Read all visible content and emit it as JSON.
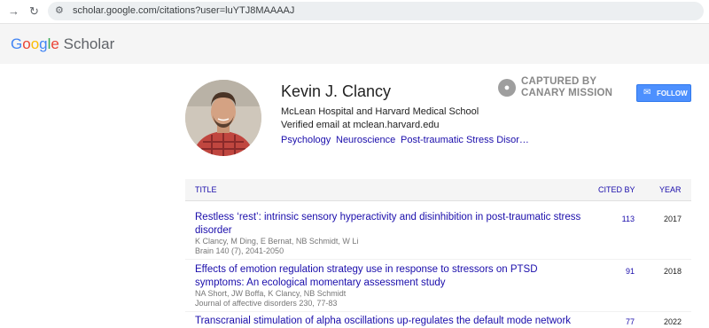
{
  "browser": {
    "back_icon": "arrow-back-icon",
    "reload_icon": "reload-icon",
    "url": "scholar.google.com/citations?user=luYTJ8MAAAAJ"
  },
  "header": {
    "logo_letters": [
      "G",
      "o",
      "o",
      "g",
      "l",
      "e"
    ],
    "logo_product": "Scholar"
  },
  "profile": {
    "name": "Kevin J. Clancy",
    "affiliation": "McLean Hospital and Harvard Medical School",
    "email": "Verified email at mclean.harvard.edu",
    "keywords": [
      "Psychology",
      "Neuroscience",
      "Post-traumatic Stress Disor…"
    ],
    "follow_label": "FOLLOW",
    "overlay_line1": "CAPTURED BY",
    "overlay_line2": "CANARY MISSION"
  },
  "table": {
    "col_title": "TITLE",
    "col_cited": "CITED BY",
    "col_year": "YEAR",
    "rows": [
      {
        "title": "Restless ‘rest’: intrinsic sensory hyperactivity and disinhibition in post-traumatic stress disorder",
        "authors": "K Clancy, M Ding, E Bernat, NB Schmidt, W Li",
        "venue": "Brain 140 (7), 2041-2050",
        "cited": "113",
        "year": "2017"
      },
      {
        "title": "Effects of emotion regulation strategy use in response to stressors on PTSD symptoms: An ecological momentary assessment study",
        "authors": "NA Short, JW Boffa, K Clancy, NB Schmidt",
        "venue": "Journal of affective disorders 230, 77-83",
        "cited": "91",
        "year": "2018"
      },
      {
        "title": "Transcranial stimulation of alpha oscillations up-regulates the default mode network",
        "cited": "77",
        "year": "2022"
      }
    ]
  }
}
